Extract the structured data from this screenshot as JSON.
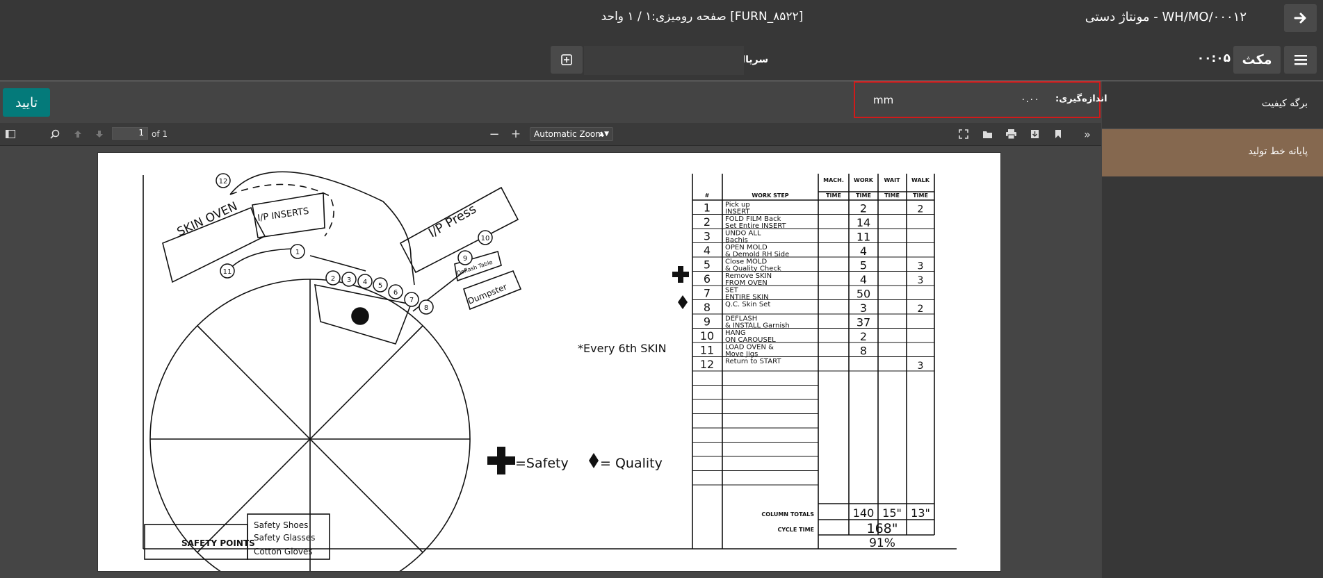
{
  "header": {
    "back_icon": "arrow-right-icon",
    "mo_title": "WH/MO/۰۰۰۱۲ - مونتاژ دستی",
    "doc_title": "[FURN_۸۵۲۲] صفحه رومیزی:۱ / ۱ واحد",
    "menu_icon": "hamburger-icon",
    "pause_label": "مکث",
    "timer": "۰۰:۰۵",
    "serial_label": "سریال",
    "serial_value": "",
    "add_serial_icon": "plus-square-icon"
  },
  "sidebar": {
    "items": [
      {
        "label": "برگه کیفیت"
      },
      {
        "label": "پایانه خط تولید"
      }
    ],
    "active_color": "#85684f"
  },
  "quality_check": {
    "confirm_label": "تایید",
    "confirm_color": "#047a7a",
    "measure_label": "اندازه‌گیری:",
    "measure_value": "۰.۰۰",
    "measure_unit": "mm",
    "highlight_color": "#d01a1a"
  },
  "pdf_toolbar": {
    "page_number": "1",
    "page_total": "of 1",
    "zoom": "Automatic Zoom"
  },
  "worksheet": {
    "headers": {
      "num": "#",
      "step": "WORK STEP",
      "mach": "MACH.",
      "work": "WORK",
      "wait": "WAIT",
      "walk": "WALK",
      "time": "TIME"
    },
    "rows": [
      {
        "n": "1",
        "step1": "Pick up",
        "step2": "INSERT",
        "work": "2",
        "walk": "2",
        "mark": ""
      },
      {
        "n": "2",
        "step1": "FOLD FILM Back",
        "step2": "Set Entire INSERT",
        "work": "14",
        "walk": "",
        "mark": ""
      },
      {
        "n": "3",
        "step1": "UNDO ALL",
        "step2": "Bachis",
        "work": "11",
        "walk": "",
        "mark": ""
      },
      {
        "n": "4",
        "step1": "OPEN MOLD",
        "step2": "& Demold RH Side",
        "work": "4",
        "walk": "",
        "mark": ""
      },
      {
        "n": "5",
        "step1": "Close MOLD",
        "step2": "& Quality Check",
        "work": "5",
        "walk": "3",
        "mark": ""
      },
      {
        "n": "6",
        "step1": "Remove SKIN",
        "step2": "FROM OVEN",
        "work": "4",
        "walk": "3",
        "mark": "safety"
      },
      {
        "n": "7",
        "step1": "SET",
        "step2": "ENTIRE SKIN",
        "work": "50",
        "walk": "",
        "mark": ""
      },
      {
        "n": "8",
        "step1": "Q.C. Skin Set",
        "step2": "",
        "work": "3",
        "walk": "2",
        "mark": "quality"
      },
      {
        "n": "9",
        "step1": "DEFLASH",
        "step2": "& INSTALL Garnish",
        "work": "37",
        "walk": "",
        "mark": ""
      },
      {
        "n": "10",
        "step1": "HANG",
        "step2": "ON CAROUSEL",
        "work": "2",
        "walk": "",
        "mark": ""
      },
      {
        "n": "11",
        "step1": "LOAD OVEN &",
        "step2": "Move Jigs",
        "work": "8",
        "walk": "",
        "mark": ""
      },
      {
        "n": "12",
        "step1": "Return to START",
        "step2": "",
        "work": "",
        "walk": "3",
        "mark": ""
      }
    ],
    "totals_label": "COLUMN TOTALS",
    "total_work": "140",
    "total_wait": "15\"",
    "total_walk": "13\"",
    "cycle_label": "CYCLE TIME",
    "cycle_value": "168\"",
    "cycle_pct": "91%",
    "every_note": "*Every 6th SKIN",
    "legend_safety": "=Safety",
    "legend_quality": "= Quality",
    "safety_points_label": "SAFETY POINTS",
    "safety_items": [
      "Safety Shoes",
      "Safety Glasses",
      "Cotton Gloves"
    ],
    "stations": {
      "skin_oven": "SKIN OVEN",
      "ip_inserts": "I/P INSERTS",
      "ip_press": "I/P Press",
      "deflash_table": "Deflash Table",
      "dumpster": "Dumpster"
    },
    "circle_numbers": [
      "1",
      "2",
      "3",
      "4",
      "5",
      "6",
      "7",
      "8",
      "9",
      "10",
      "11",
      "12"
    ]
  }
}
